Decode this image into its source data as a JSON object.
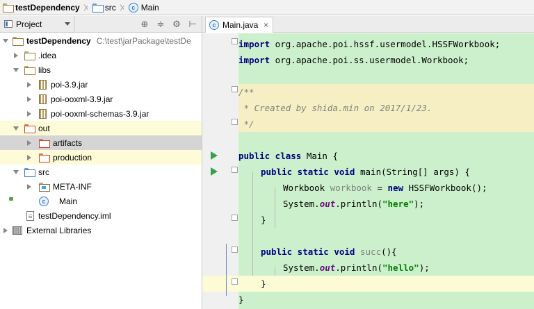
{
  "breadcrumb": {
    "project": "testDependency",
    "src": "src",
    "file": "Main"
  },
  "panel": {
    "title": "Project",
    "tools": {
      "target": "⊕",
      "collapse": "≑",
      "settings": "⚙",
      "hide": "⊢"
    }
  },
  "tree": {
    "root_name": "testDependency",
    "root_path": "C:\\test\\jarPackage\\testDe",
    "idea": ".idea",
    "libs": "libs",
    "jar1": "poi-3.9.jar",
    "jar2": "poi-ooxml-3.9.jar",
    "jar3": "poi-ooxml-schemas-3.9.jar",
    "out": "out",
    "artifacts": "artifacts",
    "production": "production",
    "src": "src",
    "metainf": "META-INF",
    "main": "Main",
    "iml": "testDependency.iml",
    "extlibs": "External Libraries"
  },
  "editor": {
    "tab_label": "Main.java",
    "tab_close": "×",
    "class_icon_letter": "c"
  },
  "code": {
    "import_kw": "import",
    "import1_pkg": " org.apache.poi.hssf.usermodel.HSSFWorkbook;",
    "import2_pkg": " org.apache.poi.ss.usermodel.Workbook;",
    "doc_open": "/**",
    "doc_body": " * Created by shida.min on 2017/1/23.",
    "doc_close": " */",
    "public_class": "public class",
    "class_rest": " Main {",
    "public_static_void": "public static void",
    "main_rest": " main(String[] args) {",
    "wb_type": "Workbook ",
    "wb_var": "workbook",
    "wb_eq": " = ",
    "new_kw": "new",
    "wb_ctor": " HSSFWorkbook();",
    "sys": "System.",
    "out_fld": "out",
    "println": ".println(",
    "str_here": "\"here\"",
    "close_paren": ");",
    "close_brace": "}",
    "succ_name": "succ",
    "succ_rest": "(){",
    "str_hello": "\"hello\""
  }
}
